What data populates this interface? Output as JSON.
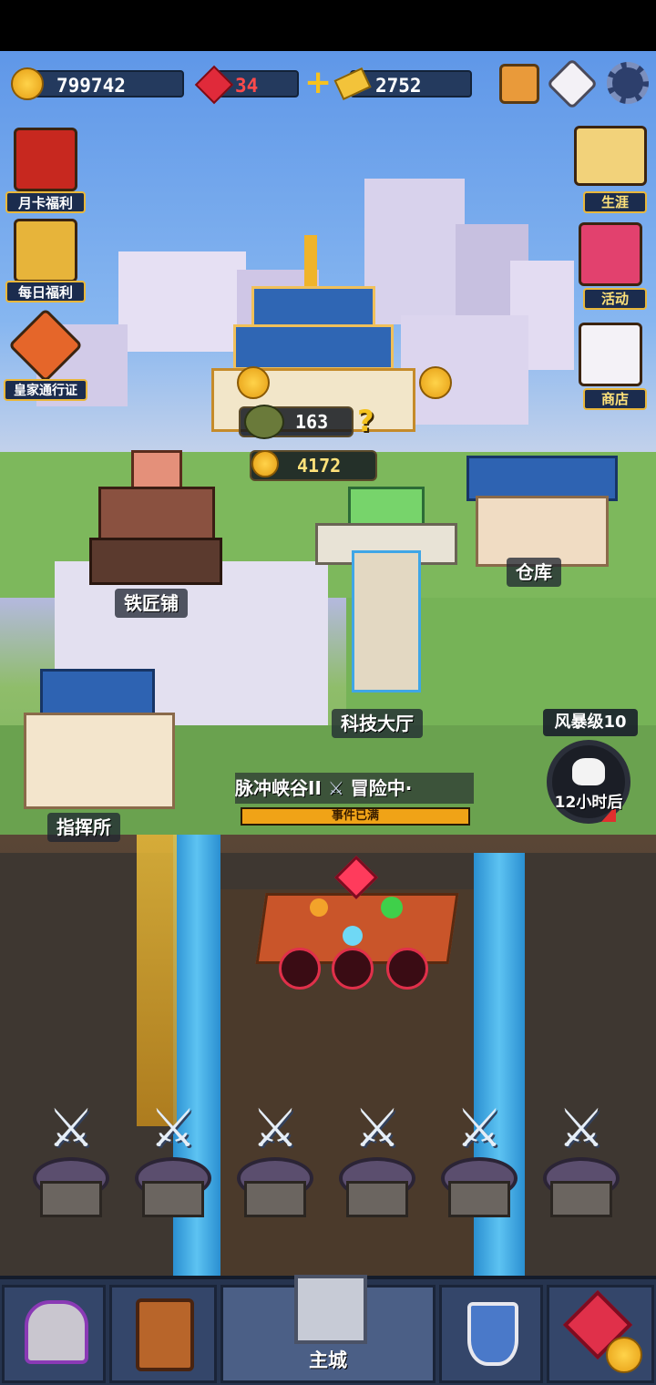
{
  "top_bar": {
    "gold": "799742",
    "gems": "34",
    "tickets": "2752"
  },
  "left_menu": [
    {
      "label": "月卡福利",
      "icon": "monthly-card-icon"
    },
    {
      "label": "每日福利",
      "icon": "daily-chest-icon"
    },
    {
      "label": "皇家通行证",
      "icon": "royal-pass-icon"
    }
  ],
  "right_menu": [
    {
      "label": "生涯",
      "icon": "career-scroll-icon"
    },
    {
      "label": "活动",
      "icon": "event-icon"
    },
    {
      "label": "商店",
      "icon": "lucky-cat-shop-icon"
    }
  ],
  "castle": {
    "food_value": "163",
    "gold_value": "4172",
    "hint_mark": "?"
  },
  "buildings": {
    "blacksmith": "铁匠铺",
    "warehouse": "仓库",
    "tech_hall": "科技大厅",
    "command_post": "指挥所"
  },
  "adventure": {
    "title": "脉冲峡谷II",
    "status": "冒险中·",
    "dots": "·",
    "bar_text": "事件已满",
    "progress": 1.0
  },
  "storm": {
    "level": "风暴级10",
    "timer": "12小时后"
  },
  "hero_slots": 6,
  "bottom_nav": {
    "tabs": [
      {
        "label": "",
        "icon": "hero-helmet-icon"
      },
      {
        "label": "",
        "icon": "tavern-beer-icon"
      },
      {
        "label": "主城",
        "icon": "main-castle-icon",
        "active": true
      },
      {
        "label": "",
        "icon": "battle-shield-icon"
      },
      {
        "label": "",
        "icon": "gem-shop-icon"
      }
    ]
  },
  "colors": {
    "accent_gold": "#f0a317",
    "gem_red": "#e02a3a",
    "panel_navy": "#243a5e"
  }
}
